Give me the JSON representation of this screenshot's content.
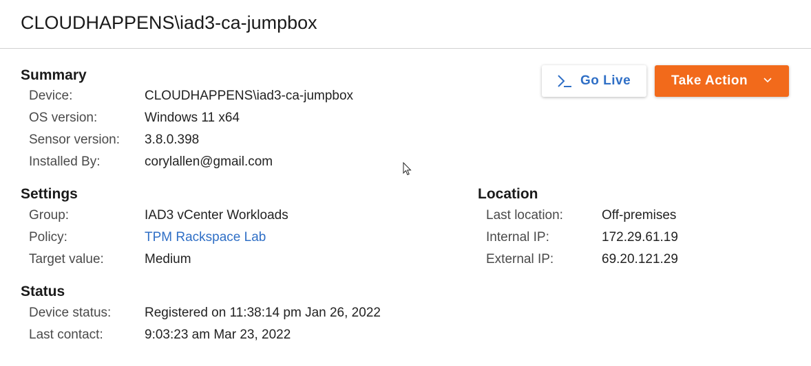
{
  "header": {
    "title": "CLOUDHAPPENS\\iad3-ca-jumpbox"
  },
  "toolbar": {
    "go_live_label": "Go Live",
    "take_action_label": "Take Action",
    "accent_color": "#f26a1b",
    "link_color": "#2f6fc6"
  },
  "summary": {
    "title": "Summary",
    "rows": [
      {
        "label": "Device:",
        "value": "CLOUDHAPPENS\\iad3-ca-jumpbox"
      },
      {
        "label": "OS version:",
        "value": "Windows 11 x64"
      },
      {
        "label": "Sensor version:",
        "value": "3.8.0.398"
      },
      {
        "label": "Installed By:",
        "value": "corylallen@gmail.com"
      }
    ]
  },
  "settings": {
    "title": "Settings",
    "rows": [
      {
        "label": "Group:",
        "value": "IAD3 vCenter Workloads"
      },
      {
        "label": "Policy:",
        "value": "TPM Rackspace Lab"
      },
      {
        "label": "Target value:",
        "value": "Medium"
      }
    ]
  },
  "status": {
    "title": "Status",
    "rows": [
      {
        "label": "Device status:",
        "value": "Registered on 11:38:14 pm Jan 26, 2022"
      },
      {
        "label": "Last contact:",
        "value": "9:03:23 am Mar 23, 2022"
      }
    ]
  },
  "location": {
    "title": "Location",
    "rows": [
      {
        "label": "Last location:",
        "value": "Off-premises"
      },
      {
        "label": "Internal IP:",
        "value": "172.29.61.19"
      },
      {
        "label": "External IP:",
        "value": "69.20.121.29"
      }
    ]
  },
  "icons": {
    "go_live": "terminal-prompt-icon",
    "take_action": "chevron-down-icon",
    "cursor": "mouse-pointer-icon"
  }
}
